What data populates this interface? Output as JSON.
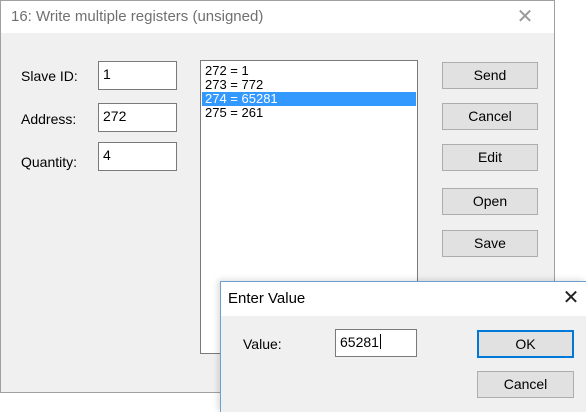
{
  "main_dialog": {
    "title": "16: Write multiple registers (unsigned)",
    "close_glyph": "✕",
    "slave_id": {
      "label": "Slave ID:",
      "value": "1"
    },
    "address": {
      "label": "Address:",
      "value": "272"
    },
    "quantity": {
      "label": "Quantity:",
      "value": "4"
    },
    "registers": [
      {
        "text": "272 = 1",
        "selected": false
      },
      {
        "text": "273 = 772",
        "selected": false
      },
      {
        "text": "274 = 65281",
        "selected": true
      },
      {
        "text": "275 = 261",
        "selected": false
      }
    ],
    "buttons": {
      "send": "Send",
      "cancel": "Cancel",
      "edit": "Edit",
      "open": "Open",
      "save": "Save"
    }
  },
  "value_dialog": {
    "title": "Enter Value",
    "close_glyph": "✕",
    "value_label": "Value:",
    "value": "65281",
    "ok_label": "OK",
    "cancel_label": "Cancel"
  },
  "colors": {
    "selection": "#3399ff",
    "dialog_bg": "#f0f0f0",
    "default_button_border": "#0078d7"
  }
}
